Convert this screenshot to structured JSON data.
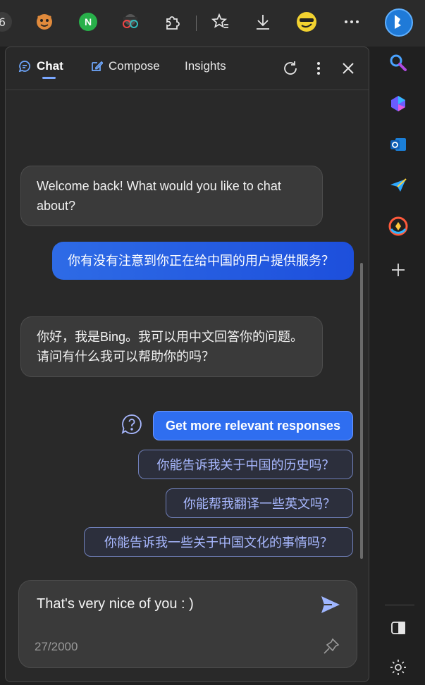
{
  "toolbar": {
    "icons": [
      "browser-tab-edge-icon",
      "extension-tiger-icon",
      "extension-n-icon",
      "extension-glasses-icon",
      "extensions-puzzle-icon",
      "favorites-icon",
      "downloads-icon",
      "profile-emoji-icon",
      "more-icon",
      "bing-copilot-icon"
    ],
    "ext_n_letter": "N"
  },
  "panel": {
    "tabs": [
      {
        "label": "Chat",
        "active": true
      },
      {
        "label": "Compose",
        "active": false
      },
      {
        "label": "Insights",
        "active": false
      }
    ]
  },
  "messages": [
    {
      "from": "bot",
      "text": "Welcome back! What would you like to chat about?"
    },
    {
      "from": "user",
      "text": "你有没有注意到你正在给中国的用户提供服务？"
    },
    {
      "from": "bot",
      "text": "你好，我是Bing。我可以用中文回答你的问题。请问有什么我可以帮助你的吗？"
    }
  ],
  "suggestions": {
    "primary": "Get more relevant responses",
    "items": [
      "你能告诉我关于中国的历史吗？",
      "你能帮我翻译一些英文吗？",
      "你能告诉我一些关于中国文化的事情吗？"
    ]
  },
  "input": {
    "value": "That's very nice of you : )",
    "counter": "27/2000"
  },
  "colors": {
    "accent": "#2f6ef0",
    "user_bubble": "#1d4fdc",
    "suggestion_text": "#a8b8ff"
  }
}
